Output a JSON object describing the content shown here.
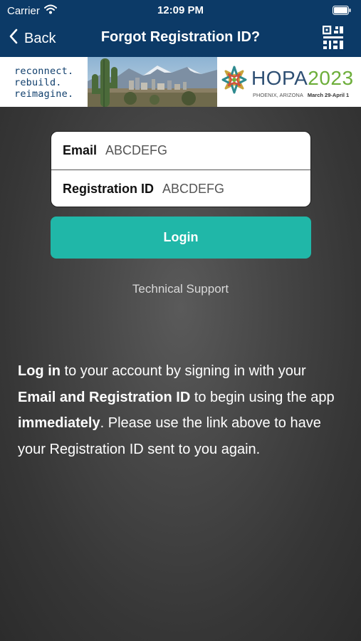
{
  "status_bar": {
    "carrier": "Carrier",
    "time": "12:09 PM",
    "wifi_icon": "wifi-icon",
    "battery_icon": "battery-icon"
  },
  "nav": {
    "back_label": "Back",
    "title": "Forgot Registration ID?",
    "qr_icon": "qr-code-icon"
  },
  "banner": {
    "tagline": [
      "reconnect.",
      "rebuild.",
      "reimagine."
    ],
    "brand_word": "HOPA",
    "brand_year": "2023",
    "location": "PHOENIX, ARIZONA",
    "dates": "March 29-April 1"
  },
  "form": {
    "email_label": "Email",
    "email_value": "ABCDEFG",
    "regid_label": "Registration ID",
    "regid_value": "ABCDEFG"
  },
  "login_label": "Login",
  "support_link": "Technical Support",
  "info": {
    "login_bold": "Log in",
    "part1": " to your account by signing in with your ",
    "credentials_bold": "Email and Registration ID",
    "part2": " to begin using the app ",
    "immediately_bold": "immediately",
    "part3": ". Please use the link above to have your Registration ID sent to you again."
  },
  "colors": {
    "nav_bg": "#0c3a67",
    "accent_teal": "#20b7a8",
    "hopa_blue": "#2e4f73",
    "hopa_green": "#6dae3a"
  }
}
